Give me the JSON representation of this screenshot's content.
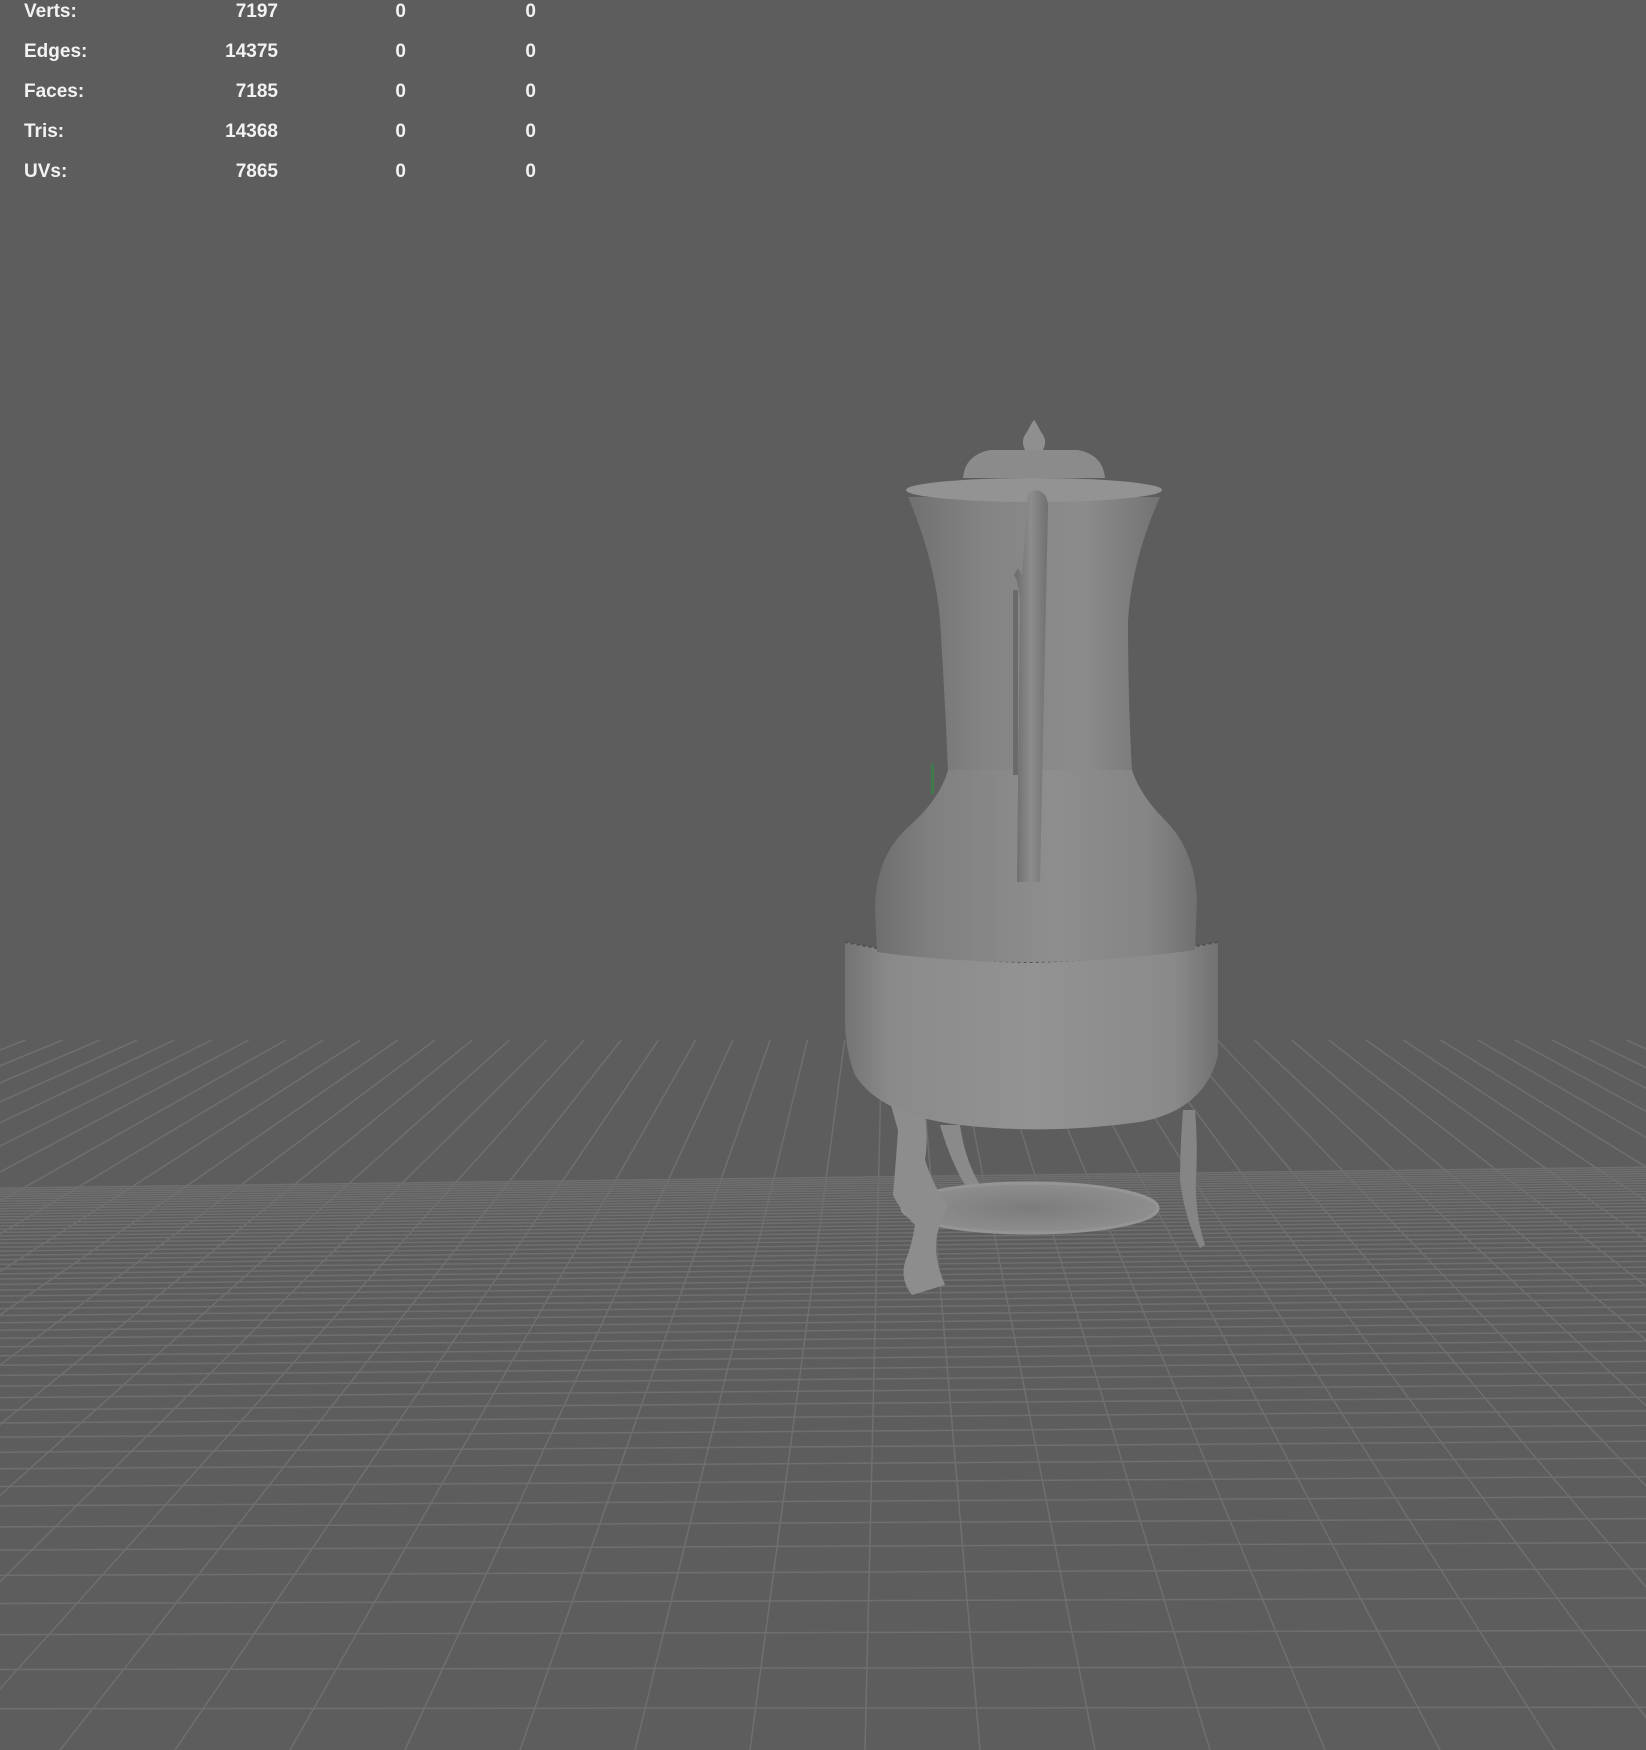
{
  "viewport": {
    "background": "#5d5d5d",
    "grid_color": "#6f6f6f",
    "model_color": "#8a8a8a"
  },
  "hud": {
    "rows": [
      {
        "label": "Verts:",
        "values": [
          "7197",
          "0",
          "0"
        ]
      },
      {
        "label": "Edges:",
        "values": [
          "14375",
          "0",
          "0"
        ]
      },
      {
        "label": "Faces:",
        "values": [
          "7185",
          "0",
          "0"
        ]
      },
      {
        "label": "Tris:",
        "values": [
          "14368",
          "0",
          "0"
        ]
      },
      {
        "label": "UVs:",
        "values": [
          "7865",
          "0",
          "0"
        ]
      }
    ]
  }
}
